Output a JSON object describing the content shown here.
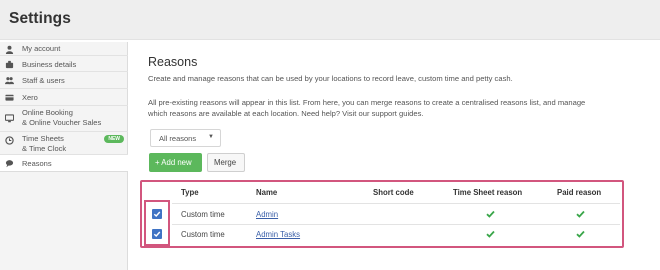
{
  "header": {
    "title": "Settings"
  },
  "sidebar": {
    "items": [
      {
        "label": "My account",
        "icon": "user-icon"
      },
      {
        "label": "Business details",
        "icon": "briefcase-icon"
      },
      {
        "label": "Staff & users",
        "icon": "users-icon"
      },
      {
        "label": "Xero",
        "icon": "card-icon"
      },
      {
        "label_line1": "Online Booking",
        "label_line2": "& Online Voucher Sales",
        "icon": "monitor-icon"
      },
      {
        "label_line1": "Time Sheets",
        "label_line2": "& Time Clock",
        "icon": "clock-icon",
        "badge": "NEW"
      },
      {
        "label": "Reasons",
        "icon": "speech-bubble-icon",
        "active": true
      }
    ]
  },
  "main": {
    "title": "Reasons",
    "description": "Create and manage reasons that can be used by your locations to record leave, custom time and petty cash.",
    "info": "All pre-existing reasons will appear in this list. From here, you can merge reasons to create a centralised reasons list, and manage which reasons are available at each location. Need help? Visit our support guides.",
    "filter": {
      "selected": "All reasons"
    },
    "add_button": "+ Add new",
    "merge_button": "Merge"
  },
  "table": {
    "columns": [
      "Type",
      "Name",
      "Short code",
      "Time Sheet reason",
      "Paid reason"
    ],
    "rows": [
      {
        "checked": true,
        "type": "Custom time",
        "name": "Admin",
        "short_code": "",
        "time_sheet_reason": true,
        "paid_reason": true
      },
      {
        "checked": true,
        "type": "Custom time",
        "name": "Admin Tasks",
        "short_code": "",
        "time_sheet_reason": true,
        "paid_reason": true
      }
    ]
  },
  "colors": {
    "accent_green": "#5cb85c",
    "checkbox_blue": "#3f73c4",
    "highlight_pink": "#d2567e",
    "tick_green": "#3aa64a"
  }
}
